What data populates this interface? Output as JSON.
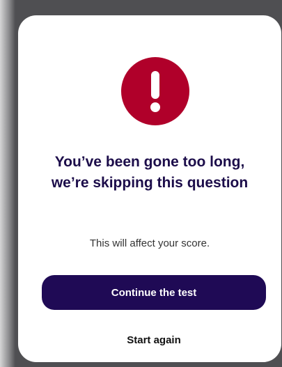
{
  "dialog": {
    "title_line_1": "You’ve been gone too long,",
    "title_line_2": "we’re skipping this question",
    "message": "This will affect your score.",
    "primary_button_label": "Continue the test",
    "secondary_button_label": "Start again",
    "icon": "exclamation-icon"
  },
  "colors": {
    "alert": "#b0002a",
    "primary": "#1f0a55",
    "title_text": "#1c0d4a"
  }
}
